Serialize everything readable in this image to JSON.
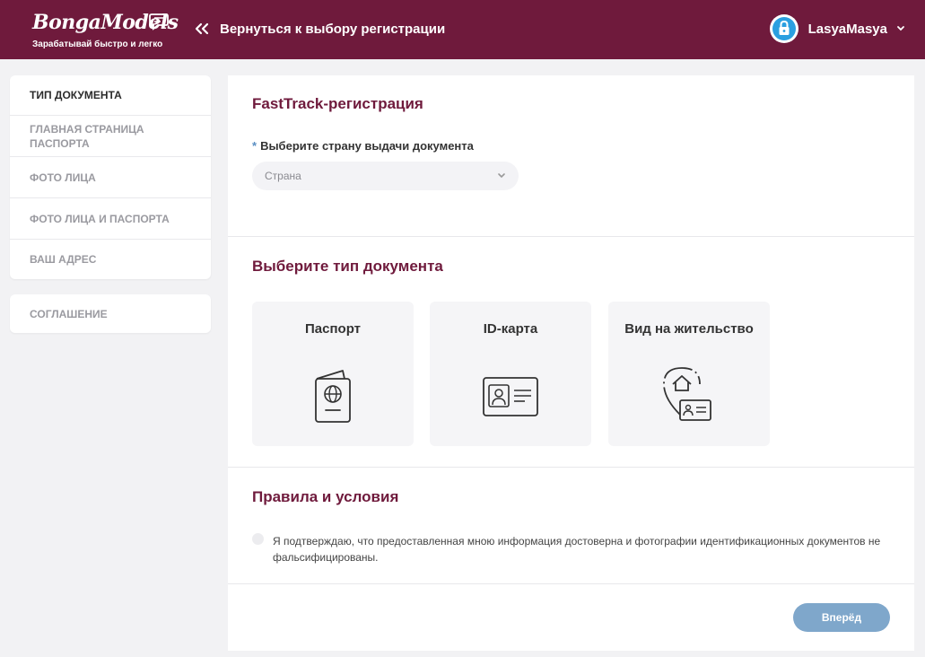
{
  "header": {
    "logo_text": "BongaModels",
    "tagline": "Зарабатывай быстро и легко",
    "back_label": "Вернуться к выбору регистрации",
    "username": "LasyaMasya",
    "background_color": "#6f1a3c"
  },
  "sidebar": {
    "steps": [
      {
        "label": "ТИП ДОКУМЕНТА",
        "active": true
      },
      {
        "label": "ГЛАВНАЯ СТРАНИЦА ПАСПОРТА",
        "active": false
      },
      {
        "label": "ФОТО ЛИЦА",
        "active": false
      },
      {
        "label": "ФОТО ЛИЦА И ПАСПОРТА",
        "active": false
      },
      {
        "label": "ВАШ АДРЕС",
        "active": false
      }
    ],
    "agreement_label": "СОГЛАШЕНИЕ"
  },
  "main": {
    "fasttrack_title": "FastTrack-регистрация",
    "country_label_star": "*",
    "country_label": "Выберите страну выдачи документа",
    "country_placeholder": "Страна",
    "doc_type_title": "Выберите тип документа",
    "documents": [
      {
        "label": "Паспорт",
        "icon": "passport-icon"
      },
      {
        "label": "ID-карта",
        "icon": "id-card-icon"
      },
      {
        "label": "Вид на жительство",
        "icon": "residence-permit-icon"
      }
    ],
    "terms_title": "Правила и условия",
    "terms_text": "Я подтверждаю, что предоставленная мною информация достоверна и фотографии идентификационных документов не фальсифицированы.",
    "next_label": "Вперёд"
  },
  "colors": {
    "accent": "#6f1a3c",
    "button": "#7fa7cb",
    "star": "#5a8fc3"
  }
}
